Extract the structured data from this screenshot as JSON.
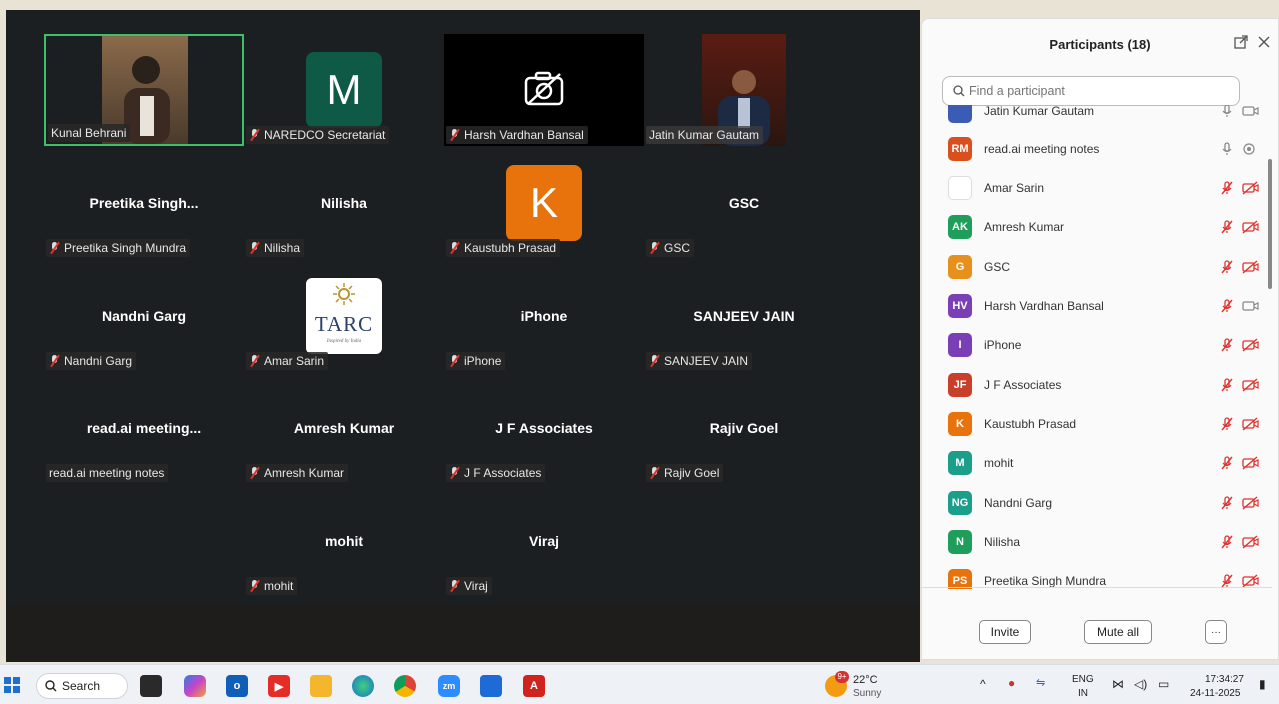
{
  "meeting": {
    "tiles": [
      {
        "id": "kunal",
        "tag": "Kunal Behrani",
        "muted": false,
        "kind": "video"
      },
      {
        "id": "naredco",
        "tag": "NAREDCO Secretariat",
        "muted": true,
        "kind": "avatar",
        "letter": "M",
        "color": "#0e5a46"
      },
      {
        "id": "harsh",
        "tag": "Harsh Vardhan Bansal",
        "muted": true,
        "kind": "camoff"
      },
      {
        "id": "jatin",
        "tag": "Jatin Kumar Gautam",
        "muted": false,
        "kind": "video"
      },
      {
        "id": "preetika",
        "title": "Preetika  Singh...",
        "tag": "Preetika Singh Mundra",
        "muted": true
      },
      {
        "id": "nilisha",
        "title": "Nilisha",
        "tag": "Nilisha",
        "muted": true
      },
      {
        "id": "kaustubh",
        "tag": "Kaustubh Prasad",
        "muted": true,
        "kind": "avatar",
        "letter": "K",
        "color": "#e8720c"
      },
      {
        "id": "gsc",
        "title": "GSC",
        "tag": "GSC",
        "muted": true
      },
      {
        "id": "nandni",
        "title": "Nandni Garg",
        "tag": "Nandni Garg",
        "muted": true
      },
      {
        "id": "amar",
        "tag": "Amar Sarin",
        "muted": true,
        "kind": "logo",
        "logo_text": "TARC",
        "logo_sub": "Inspired by India"
      },
      {
        "id": "iphone",
        "title": "iPhone",
        "tag": "iPhone",
        "muted": true
      },
      {
        "id": "sanjeev",
        "title": "SANJEEV JAIN",
        "tag": "SANJEEV JAIN",
        "muted": true
      },
      {
        "id": "readai",
        "title": "read.ai  meeting...",
        "tag": "read.ai meeting notes",
        "muted": false
      },
      {
        "id": "amresh",
        "title": "Amresh Kumar",
        "tag": "Amresh Kumar",
        "muted": true
      },
      {
        "id": "jf",
        "title": "J F Associates",
        "tag": "J F Associates",
        "muted": true
      },
      {
        "id": "rajiv",
        "title": "Rajiv Goel",
        "tag": "Rajiv Goel",
        "muted": true
      },
      {
        "id": "mohit",
        "title": "mohit",
        "tag": "mohit",
        "muted": true
      },
      {
        "id": "viraj",
        "title": "Viraj",
        "tag": "Viraj",
        "muted": true
      }
    ]
  },
  "panel": {
    "title": "Participants (18)",
    "search_placeholder": "Find a participant",
    "participants": [
      {
        "initials": "",
        "name": "Jatin Kumar Gautam",
        "color": "#3b5bb5",
        "mic": "on",
        "cam": "on"
      },
      {
        "initials": "RM",
        "name": "read.ai meeting notes",
        "color": "#d9501e",
        "mic": "on",
        "cam": "rec"
      },
      {
        "initials": "",
        "name": "Amar Sarin",
        "color": "#ffffff",
        "mic": "off",
        "cam": "off"
      },
      {
        "initials": "AK",
        "name": "Amresh Kumar",
        "color": "#1e9e5a",
        "mic": "off",
        "cam": "off"
      },
      {
        "initials": "G",
        "name": "GSC",
        "color": "#e8901c",
        "mic": "off",
        "cam": "off"
      },
      {
        "initials": "HV",
        "name": "Harsh Vardhan Bansal",
        "color": "#7b3fb5",
        "mic": "off",
        "cam": "on"
      },
      {
        "initials": "I",
        "name": "iPhone",
        "color": "#7b3fb5",
        "mic": "off",
        "cam": "off"
      },
      {
        "initials": "JF",
        "name": "J F Associates",
        "color": "#c8402a",
        "mic": "off",
        "cam": "off"
      },
      {
        "initials": "K",
        "name": "Kaustubh Prasad",
        "color": "#e8720c",
        "mic": "off",
        "cam": "off"
      },
      {
        "initials": "M",
        "name": "mohit",
        "color": "#1b9e8a",
        "mic": "off",
        "cam": "off"
      },
      {
        "initials": "NG",
        "name": "Nandni Garg",
        "color": "#1b9e8a",
        "mic": "off",
        "cam": "off"
      },
      {
        "initials": "N",
        "name": "Nilisha",
        "color": "#1e9e5a",
        "mic": "off",
        "cam": "off"
      },
      {
        "initials": "PS",
        "name": "Preetika Singh Mundra",
        "color": "#e8720c",
        "mic": "off",
        "cam": "off"
      }
    ],
    "invite_label": "Invite",
    "mute_all_label": "Mute all",
    "more_label": "···"
  },
  "taskbar": {
    "search_label": "Search",
    "weather_temp": "22°C",
    "weather_desc": "Sunny",
    "weather_badge": "9+",
    "lang_top": "ENG",
    "lang_bottom": "IN",
    "time": "17:34:27",
    "date": "24-11-2025"
  }
}
